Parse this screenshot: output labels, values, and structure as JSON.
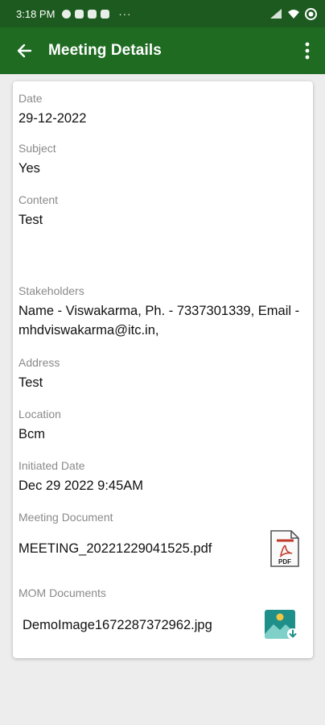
{
  "status_bar": {
    "time": "3:18 PM"
  },
  "app_bar": {
    "title": "Meeting Details"
  },
  "fields": {
    "date": {
      "label": "Date",
      "value": "29-12-2022"
    },
    "subject": {
      "label": "Subject",
      "value": "Yes"
    },
    "content": {
      "label": "Content",
      "value": "Test"
    },
    "stakeholders": {
      "label": "Stakeholders",
      "value": "Name - Viswakarma, Ph. - 7337301339, Email - mhdviswakarma@itc.in,"
    },
    "address": {
      "label": "Address",
      "value": "Test"
    },
    "location": {
      "label": "Location",
      "value": "Bcm"
    },
    "initiated_date": {
      "label": "Initiated Date",
      "value": "Dec 29 2022  9:45AM"
    }
  },
  "meeting_document": {
    "label": "Meeting Document",
    "file_name": "MEETING_20221229041525.pdf",
    "icon": "pdf-file-icon",
    "icon_text": "PDF"
  },
  "mom_documents": {
    "label": "MOM Documents",
    "file_name": "DemoImage1672287372962.jpg",
    "icon": "image-download-icon"
  },
  "colors": {
    "status_bar": "#1d5a1f",
    "app_bar": "#1f6b22",
    "pdf_red": "#c0392b",
    "image_teal": "#1f8f8a"
  }
}
